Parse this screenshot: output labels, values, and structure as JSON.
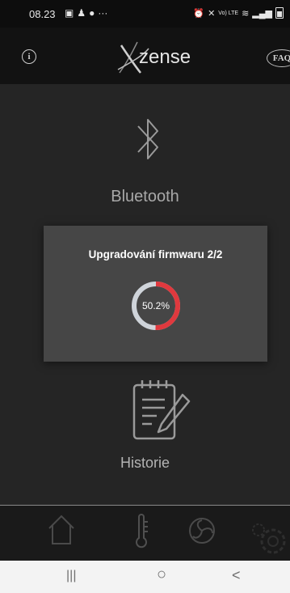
{
  "status_bar": {
    "time": "08.23",
    "notif_icons": [
      "image-icon",
      "person-icon",
      "facebook-icon"
    ],
    "more": "···",
    "right_icons": [
      "alarm-icon",
      "mute-icon",
      "volte-icon",
      "wifi-icon",
      "signal-icon",
      "battery-icon"
    ],
    "volte": "Vo) LTE"
  },
  "header": {
    "info_symbol": "i",
    "logo_text": "zense",
    "faq_label": "FAQ"
  },
  "main": {
    "bluetooth_label": "Bluetooth",
    "history_label": "Historie"
  },
  "dialog": {
    "title": "Upgradování firmwaru 2/2",
    "progress_text": "50.2%",
    "progress_fraction": 0.502,
    "colors": {
      "progress": "#e0393e",
      "track": "#cfd4da"
    }
  },
  "bottom_nav": {
    "items": [
      "home-icon",
      "thermometer-icon",
      "fan-icon",
      "settings-icon"
    ]
  },
  "system_nav": {
    "recents": "|||",
    "home": "○",
    "back": "<"
  },
  "colors": {
    "background": "#252525",
    "header": "#121212",
    "dialog": "#464646"
  }
}
